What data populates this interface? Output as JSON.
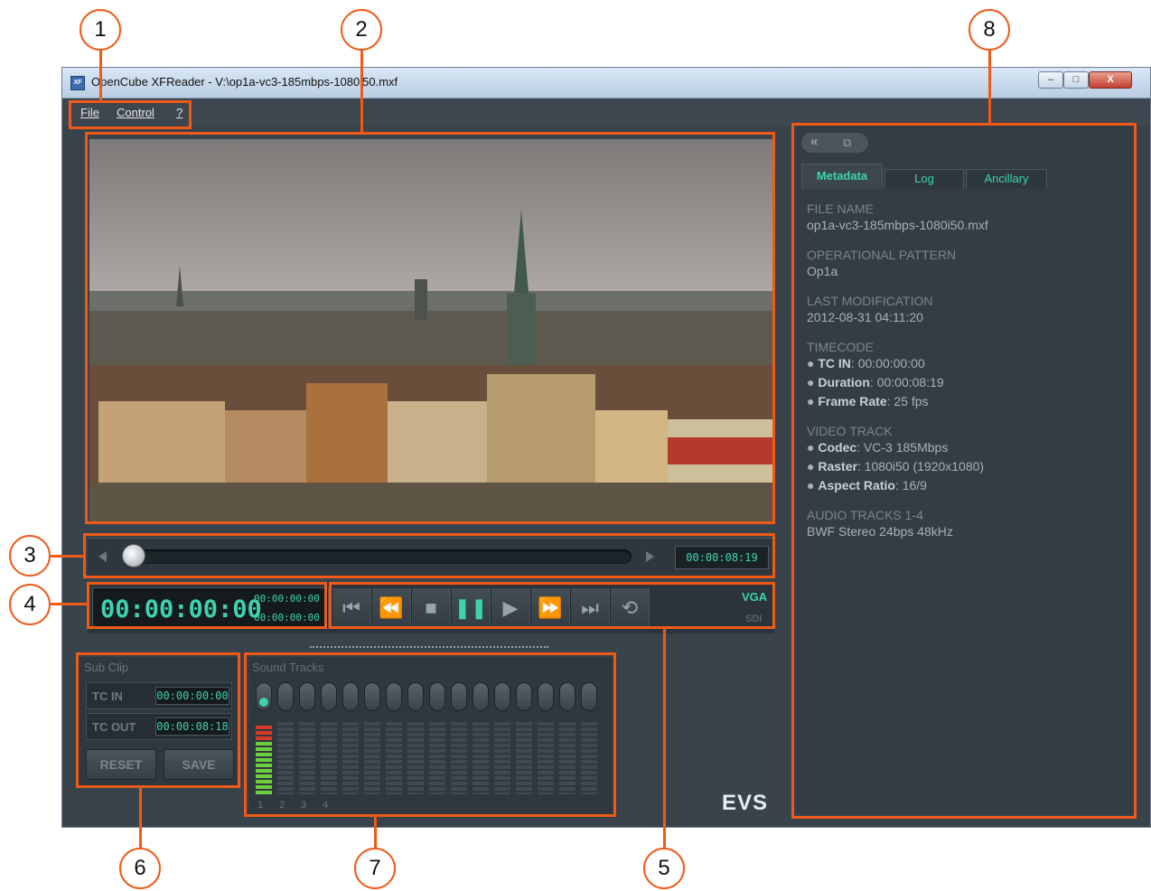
{
  "window": {
    "title": "OpenCube XFReader - V:\\op1a-vc3-185mbps-1080i50.mxf",
    "app_icon": "XF",
    "minimize": "–",
    "maximize": "□",
    "close": "X"
  },
  "menu": [
    "File",
    "Control",
    "?"
  ],
  "seek": {
    "time": "00:00:08:19",
    "position": 0.0
  },
  "transport": {
    "timecode": "00:00:00:00",
    "tc_in": "00:00:00:00",
    "tc_out": "00:00:00:00",
    "vga": "VGA",
    "sdi": "SDI",
    "icons": [
      "skip-start-icon",
      "rewind-icon",
      "stop-icon",
      "pause-icon",
      "play-icon",
      "fast-forward-icon",
      "skip-end-icon",
      "loop-icon"
    ]
  },
  "subclip": {
    "title": "Sub Clip",
    "tc_in_label": "TC IN",
    "tc_in_value": "00:00:00:00",
    "tc_out_label": "TC OUT",
    "tc_out_value": "00:00:08:18",
    "reset": "RESET",
    "save": "SAVE"
  },
  "sound": {
    "title": "Sound Tracks",
    "track_numbers": [
      "1",
      "2",
      "3",
      "4"
    ],
    "track_count": 16,
    "active_track": 1
  },
  "logo": "EVS",
  "panel": {
    "tabs": [
      "Metadata",
      "Log",
      "Ancillary"
    ],
    "active_tab": "Metadata",
    "file_name_h": "FILE NAME",
    "file_name": "op1a-vc3-185mbps-1080i50.mxf",
    "op_h": "OPERATIONAL PATTERN",
    "op": "Op1a",
    "mod_h": "LAST MODIFICATION",
    "mod": "2012-08-31 04:11:20",
    "tc_h": "TIMECODE",
    "tc_in_k": "TC IN",
    "tc_in_v": ": 00:00:00:00",
    "dur_k": "Duration",
    "dur_v": ": 00:00:08:19",
    "fr_k": "Frame Rate",
    "fr_v": ": 25 fps",
    "vt_h": "VIDEO TRACK",
    "codec_k": "Codec",
    "codec_v": ": VC-3 185Mbps",
    "raster_k": "Raster",
    "raster_v": ": 1080i50 (1920x1080)",
    "ar_k": "Aspect Ratio",
    "ar_v": ": 16/9",
    "audio_h": "AUDIO TRACKS 1-4",
    "audio": "BWF Stereo 24bps 48kHz"
  },
  "callouts": [
    "1",
    "2",
    "3",
    "4",
    "5",
    "6",
    "7",
    "8"
  ]
}
